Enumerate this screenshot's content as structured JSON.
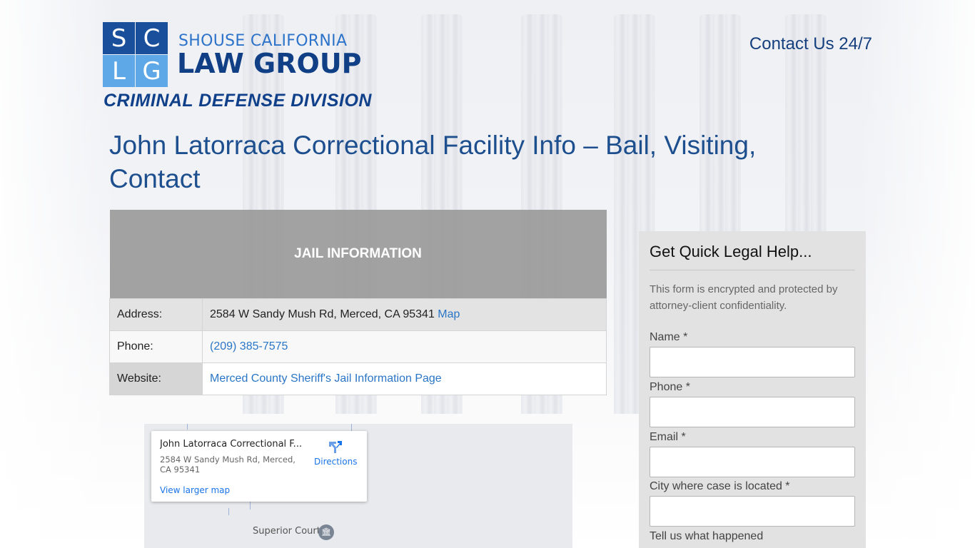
{
  "logo": {
    "letters": [
      "S",
      "C",
      "L",
      "G"
    ],
    "top_line": "SHOUSE CALIFORNIA",
    "main_line": "LAW GROUP"
  },
  "division": "CRIMINAL DEFENSE DIVISION",
  "header": {
    "contact": "Contact Us 24/7"
  },
  "page": {
    "title": "John Latorraca Correctional Facility Info – Bail, Visiting, Contact"
  },
  "jail_info": {
    "heading": "JAIL INFORMATION",
    "address_label": "Address:",
    "address_value": "2584 W Sandy Mush Rd, Merced, CA 95341",
    "map_link": "Map",
    "phone_label": "Phone:",
    "phone_value": "(209) 385-7575",
    "website_label": "Website:",
    "website_value": "Merced County Sheriff's Jail Information Page"
  },
  "map": {
    "place_name": "John Latorraca Correctional F...",
    "address": "2584 W Sandy Mush Rd, Merced, CA 95341",
    "directions": "Directions",
    "view_larger": "View larger map",
    "poi": "Superior Court"
  },
  "form": {
    "heading": "Get Quick Legal Help...",
    "note": "This form is encrypted and protected by attorney-client confidentiality.",
    "name_label": "Name *",
    "phone_label": "Phone *",
    "email_label": "Email *",
    "city_label": "City where case is located *",
    "happened_label": "Tell us what happened",
    "name_value": "",
    "phone_value": "",
    "email_value": "",
    "city_value": ""
  },
  "colors": {
    "brand_dark": "#1a4f9c",
    "brand_light": "#5fa8e8",
    "title_blue": "#1d4f8f",
    "link_blue": "#2a76c6"
  }
}
